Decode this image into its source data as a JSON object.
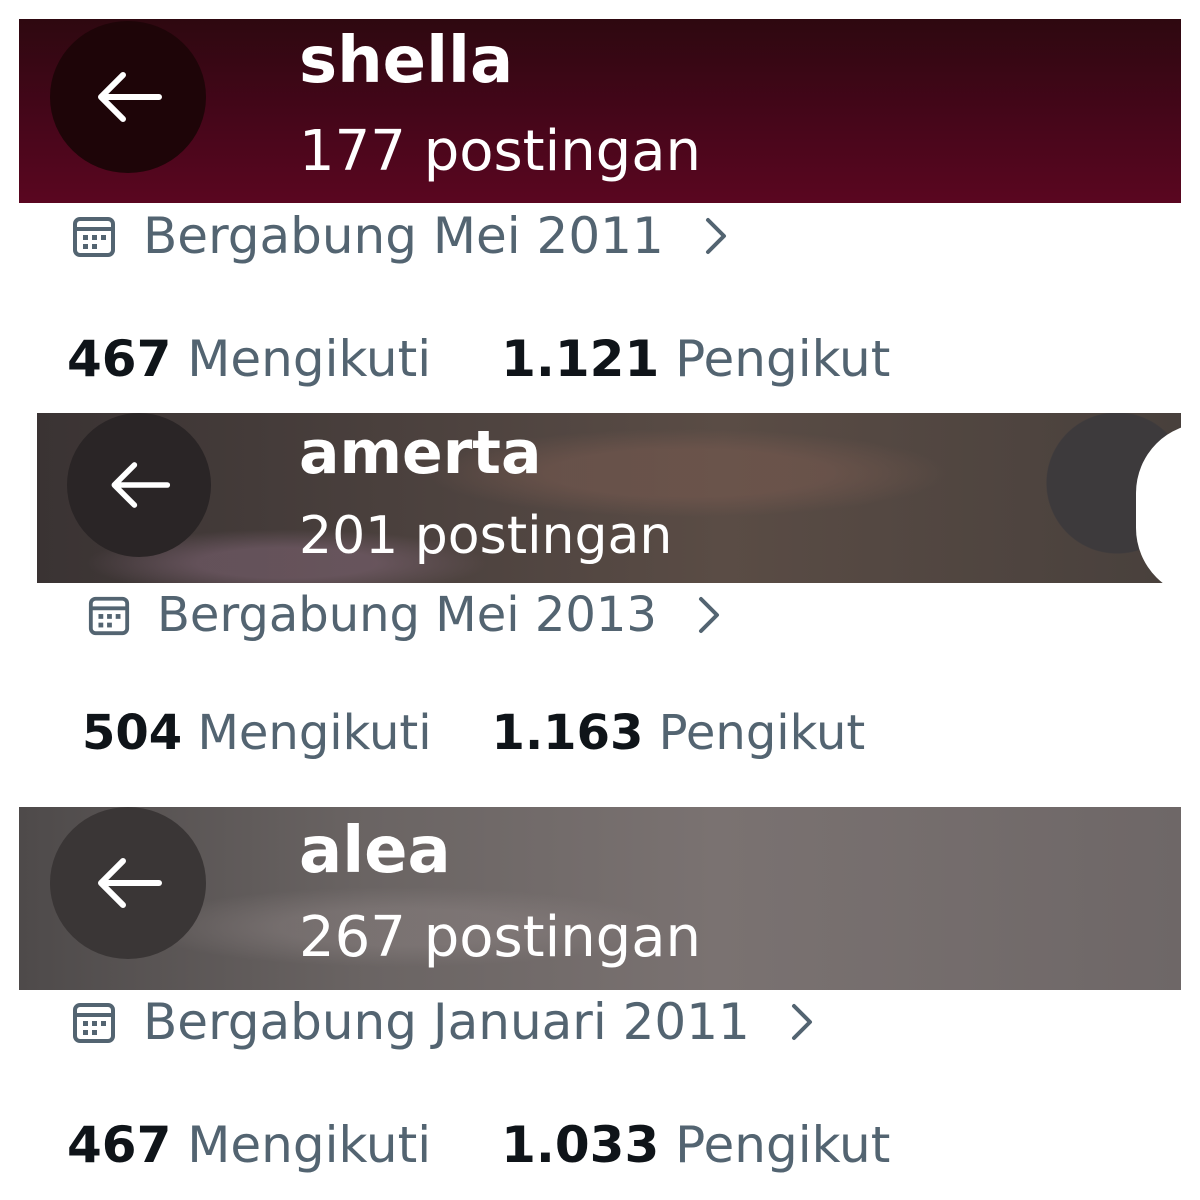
{
  "profiles": [
    {
      "name": "shella",
      "posts": "177 postingan",
      "joined": "Bergabung Mei 2011",
      "following_count": "467",
      "following_label": "Mengikuti",
      "followers_count": "1.121",
      "followers_label": "Pengikut",
      "header_color": "#46061a"
    },
    {
      "name": "amerta",
      "posts": "201 postingan",
      "joined": "Bergabung Mei 2013",
      "following_count": "504",
      "following_label": "Mengikuti",
      "followers_count": "1.163",
      "followers_label": "Pengikut",
      "header_color": "#4f4440"
    },
    {
      "name": "alea",
      "posts": "267 postingan",
      "joined": "Bergabung Januari 2011",
      "following_count": "467",
      "following_label": "Mengikuti",
      "followers_count": "1.033",
      "followers_label": "Pengikut",
      "header_color": "#6a6463"
    }
  ],
  "icons": {
    "back": "arrow-left-icon",
    "calendar": "calendar-icon",
    "chevron": "chevron-right-icon"
  },
  "colors": {
    "secondary_text": "#536471",
    "primary_text": "#0f1419"
  }
}
